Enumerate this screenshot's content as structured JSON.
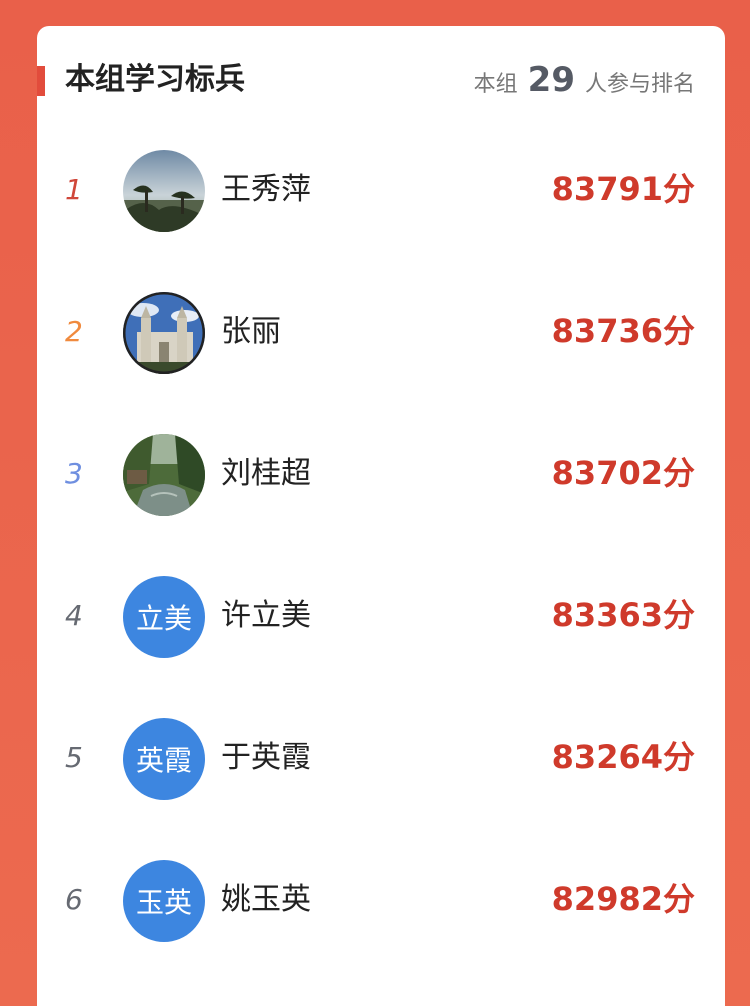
{
  "header": {
    "title": "本组学习标兵",
    "participants_prefix": "本组",
    "participants_count": "29",
    "participants_suffix": "人参与排名"
  },
  "colors": {
    "accent": "#e24c3c",
    "score": "#cf3a2b",
    "avatar_blue": "#3d86e0",
    "rank1": "#d0473a",
    "rank2": "#f08a3e",
    "rank3": "#6f8fe0",
    "rank_default": "#666a72"
  },
  "rankings": [
    {
      "rank": "1",
      "name": "王秀萍",
      "score": "83791分",
      "avatar_type": "photo",
      "avatar_icon": "landscape-photo"
    },
    {
      "rank": "2",
      "name": "张丽",
      "score": "83736分",
      "avatar_type": "photo",
      "avatar_icon": "castle-photo"
    },
    {
      "rank": "3",
      "name": "刘桂超",
      "score": "83702分",
      "avatar_type": "photo",
      "avatar_icon": "canal-photo"
    },
    {
      "rank": "4",
      "name": "许立美",
      "score": "83363分",
      "avatar_type": "text",
      "avatar_text": "立美"
    },
    {
      "rank": "5",
      "name": "于英霞",
      "score": "83264分",
      "avatar_type": "text",
      "avatar_text": "英霞"
    },
    {
      "rank": "6",
      "name": "姚玉英",
      "score": "82982分",
      "avatar_type": "text",
      "avatar_text": "玉英"
    }
  ]
}
